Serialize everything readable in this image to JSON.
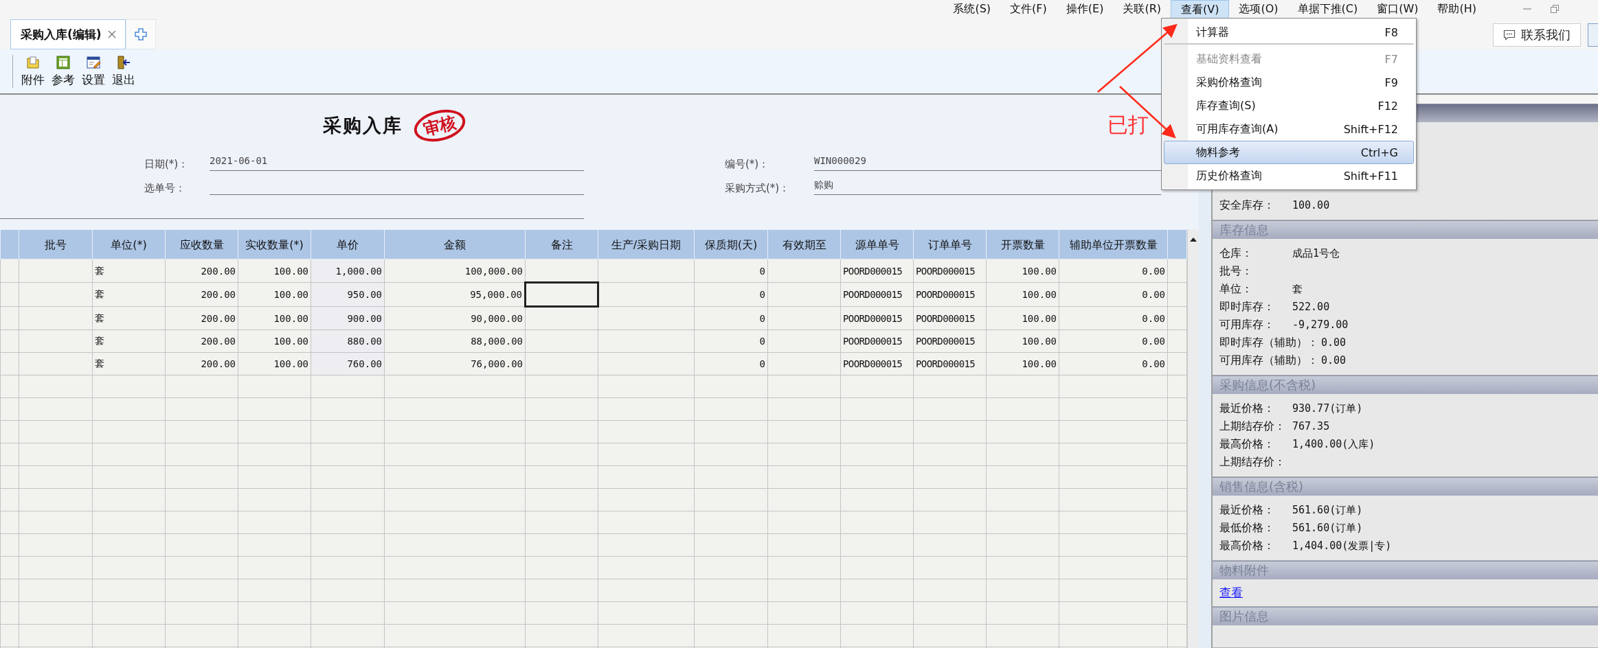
{
  "menu_bar": {
    "items": [
      {
        "label": "系统(S)",
        "selected": false
      },
      {
        "label": "文件(F)",
        "selected": false
      },
      {
        "label": "操作(E)",
        "selected": false
      },
      {
        "label": "关联(R)",
        "selected": false
      },
      {
        "label": "查看(V)",
        "selected": true
      },
      {
        "label": "选项(O)",
        "selected": false
      },
      {
        "label": "单据下推(C)",
        "selected": false
      },
      {
        "label": "窗口(W)",
        "selected": false
      },
      {
        "label": "帮助(H)",
        "selected": false
      }
    ]
  },
  "tabs": [
    {
      "label": "采购入库(编辑)",
      "selected": true
    }
  ],
  "contact_button": {
    "label": "联系我们"
  },
  "toolbar": [
    {
      "label": "附件",
      "kind": "attach"
    },
    {
      "label": "参考",
      "kind": "reference"
    },
    {
      "label": "设置",
      "kind": "settings"
    },
    {
      "label": "退出",
      "kind": "exit"
    }
  ],
  "form": {
    "title": "采购入库",
    "stamp": "审核",
    "printed_note": "已打",
    "fields": [
      {
        "label": "日期(*)：",
        "value": "2021-06-01"
      },
      {
        "label": "编号(*)：",
        "value": "WIN000029"
      },
      {
        "label": "选单号："
      },
      {
        "label": "采购方式(*)：",
        "value": "赊购"
      }
    ]
  },
  "table": {
    "columns": [
      "批号",
      "单位(*)",
      "应收数量",
      "实收数量(*)",
      "单价",
      "金额",
      "备注",
      "生产/采购日期",
      "保质期(天)",
      "有效期至",
      "源单单号",
      "订单单号",
      "开票数量",
      "辅助单位开票数量"
    ],
    "rows": [
      {
        "unit": "套",
        "qty_due": "200.00",
        "qty_received": "100.00",
        "price": "1,000.00",
        "amount": "100,000.00",
        "shelf_days": "0",
        "source_no": "POORD000015",
        "order_no": "POORD000015",
        "invoiced_qty": "100.00",
        "aux_invoiced_qty": "0.00",
        "remark_selected": false
      },
      {
        "unit": "套",
        "qty_due": "200.00",
        "qty_received": "100.00",
        "price": "950.00",
        "amount": "95,000.00",
        "shelf_days": "0",
        "source_no": "POORD000015",
        "order_no": "POORD000015",
        "invoiced_qty": "100.00",
        "aux_invoiced_qty": "0.00",
        "remark_selected": true
      },
      {
        "unit": "套",
        "qty_due": "200.00",
        "qty_received": "100.00",
        "price": "900.00",
        "amount": "90,000.00",
        "shelf_days": "0",
        "source_no": "POORD000015",
        "order_no": "POORD000015",
        "invoiced_qty": "100.00",
        "aux_invoiced_qty": "0.00",
        "remark_selected": false
      },
      {
        "unit": "套",
        "qty_due": "200.00",
        "qty_received": "100.00",
        "price": "880.00",
        "amount": "88,000.00",
        "shelf_days": "0",
        "source_no": "POORD000015",
        "order_no": "POORD000015",
        "invoiced_qty": "100.00",
        "aux_invoiced_qty": "0.00",
        "remark_selected": false
      },
      {
        "unit": "套",
        "qty_due": "200.00",
        "qty_received": "100.00",
        "price": "760.00",
        "amount": "76,000.00",
        "shelf_days": "0",
        "source_no": "POORD000015",
        "order_no": "POORD000015",
        "invoiced_qty": "100.00",
        "aux_invoiced_qty": "0.00",
        "remark_selected": false
      }
    ]
  },
  "dropdown_menu": {
    "items": [
      {
        "label": "计算器",
        "shortcut": "F8",
        "disabled": false,
        "selected": false,
        "separator_after": true
      },
      {
        "label": "基础资料查看",
        "shortcut": "F7",
        "disabled": true,
        "selected": false,
        "separator_after": false
      },
      {
        "label": "采购价格查询",
        "shortcut": "F9",
        "disabled": false,
        "selected": false,
        "separator_after": false
      },
      {
        "label": "库存查询(S)",
        "shortcut": "F12",
        "disabled": false,
        "selected": false,
        "separator_after": false
      },
      {
        "label": "可用库存查询(A)",
        "shortcut": "Shift+F12",
        "disabled": false,
        "selected": false,
        "separator_after": false
      },
      {
        "label": "物料参考",
        "shortcut": "Ctrl+G",
        "disabled": false,
        "selected": true,
        "separator_after": false
      },
      {
        "label": "历史价格查询",
        "shortcut": "Shift+F11",
        "disabled": false,
        "selected": false,
        "separator_after": false
      }
    ]
  },
  "side_panel": {
    "sections": [
      {
        "kind": "info",
        "items": [
          {
            "label": "安全库存：",
            "value": "100.00"
          }
        ]
      },
      {
        "title": "库存信息",
        "kind": "info",
        "items": [
          {
            "label": "仓库：",
            "value": "成品1号仓"
          },
          {
            "label": "批号："
          },
          {
            "label": "单位：",
            "value": "套"
          },
          {
            "label": "即时库存：",
            "value": "522.00"
          },
          {
            "label": "可用库存：",
            "value": "-9,279.00"
          },
          {
            "label": "即时库存（辅助）：",
            "value": "0.00"
          },
          {
            "label": "可用库存（辅助）：",
            "value": "0.00"
          }
        ]
      },
      {
        "title": "采购信息(不含税)",
        "kind": "info",
        "items": [
          {
            "label": "最近价格：",
            "value": "930.77(订单)"
          },
          {
            "label": "上期结存价：",
            "value": "767.35"
          },
          {
            "label": "最高价格：",
            "value": "1,400.00(入库)"
          },
          {
            "label": "上期结存价："
          }
        ]
      },
      {
        "title": "销售信息(含税)",
        "kind": "info",
        "items": [
          {
            "label": "最近价格：",
            "value": "561.60(订单)"
          },
          {
            "label": "最低价格：",
            "value": "561.60(订单)"
          },
          {
            "label": "最高价格：",
            "value": "1,404.00(发票|专)"
          }
        ]
      },
      {
        "title": "物料附件",
        "kind": "link",
        "link": "查看"
      },
      {
        "title": "图片信息",
        "kind": "picture"
      }
    ]
  }
}
